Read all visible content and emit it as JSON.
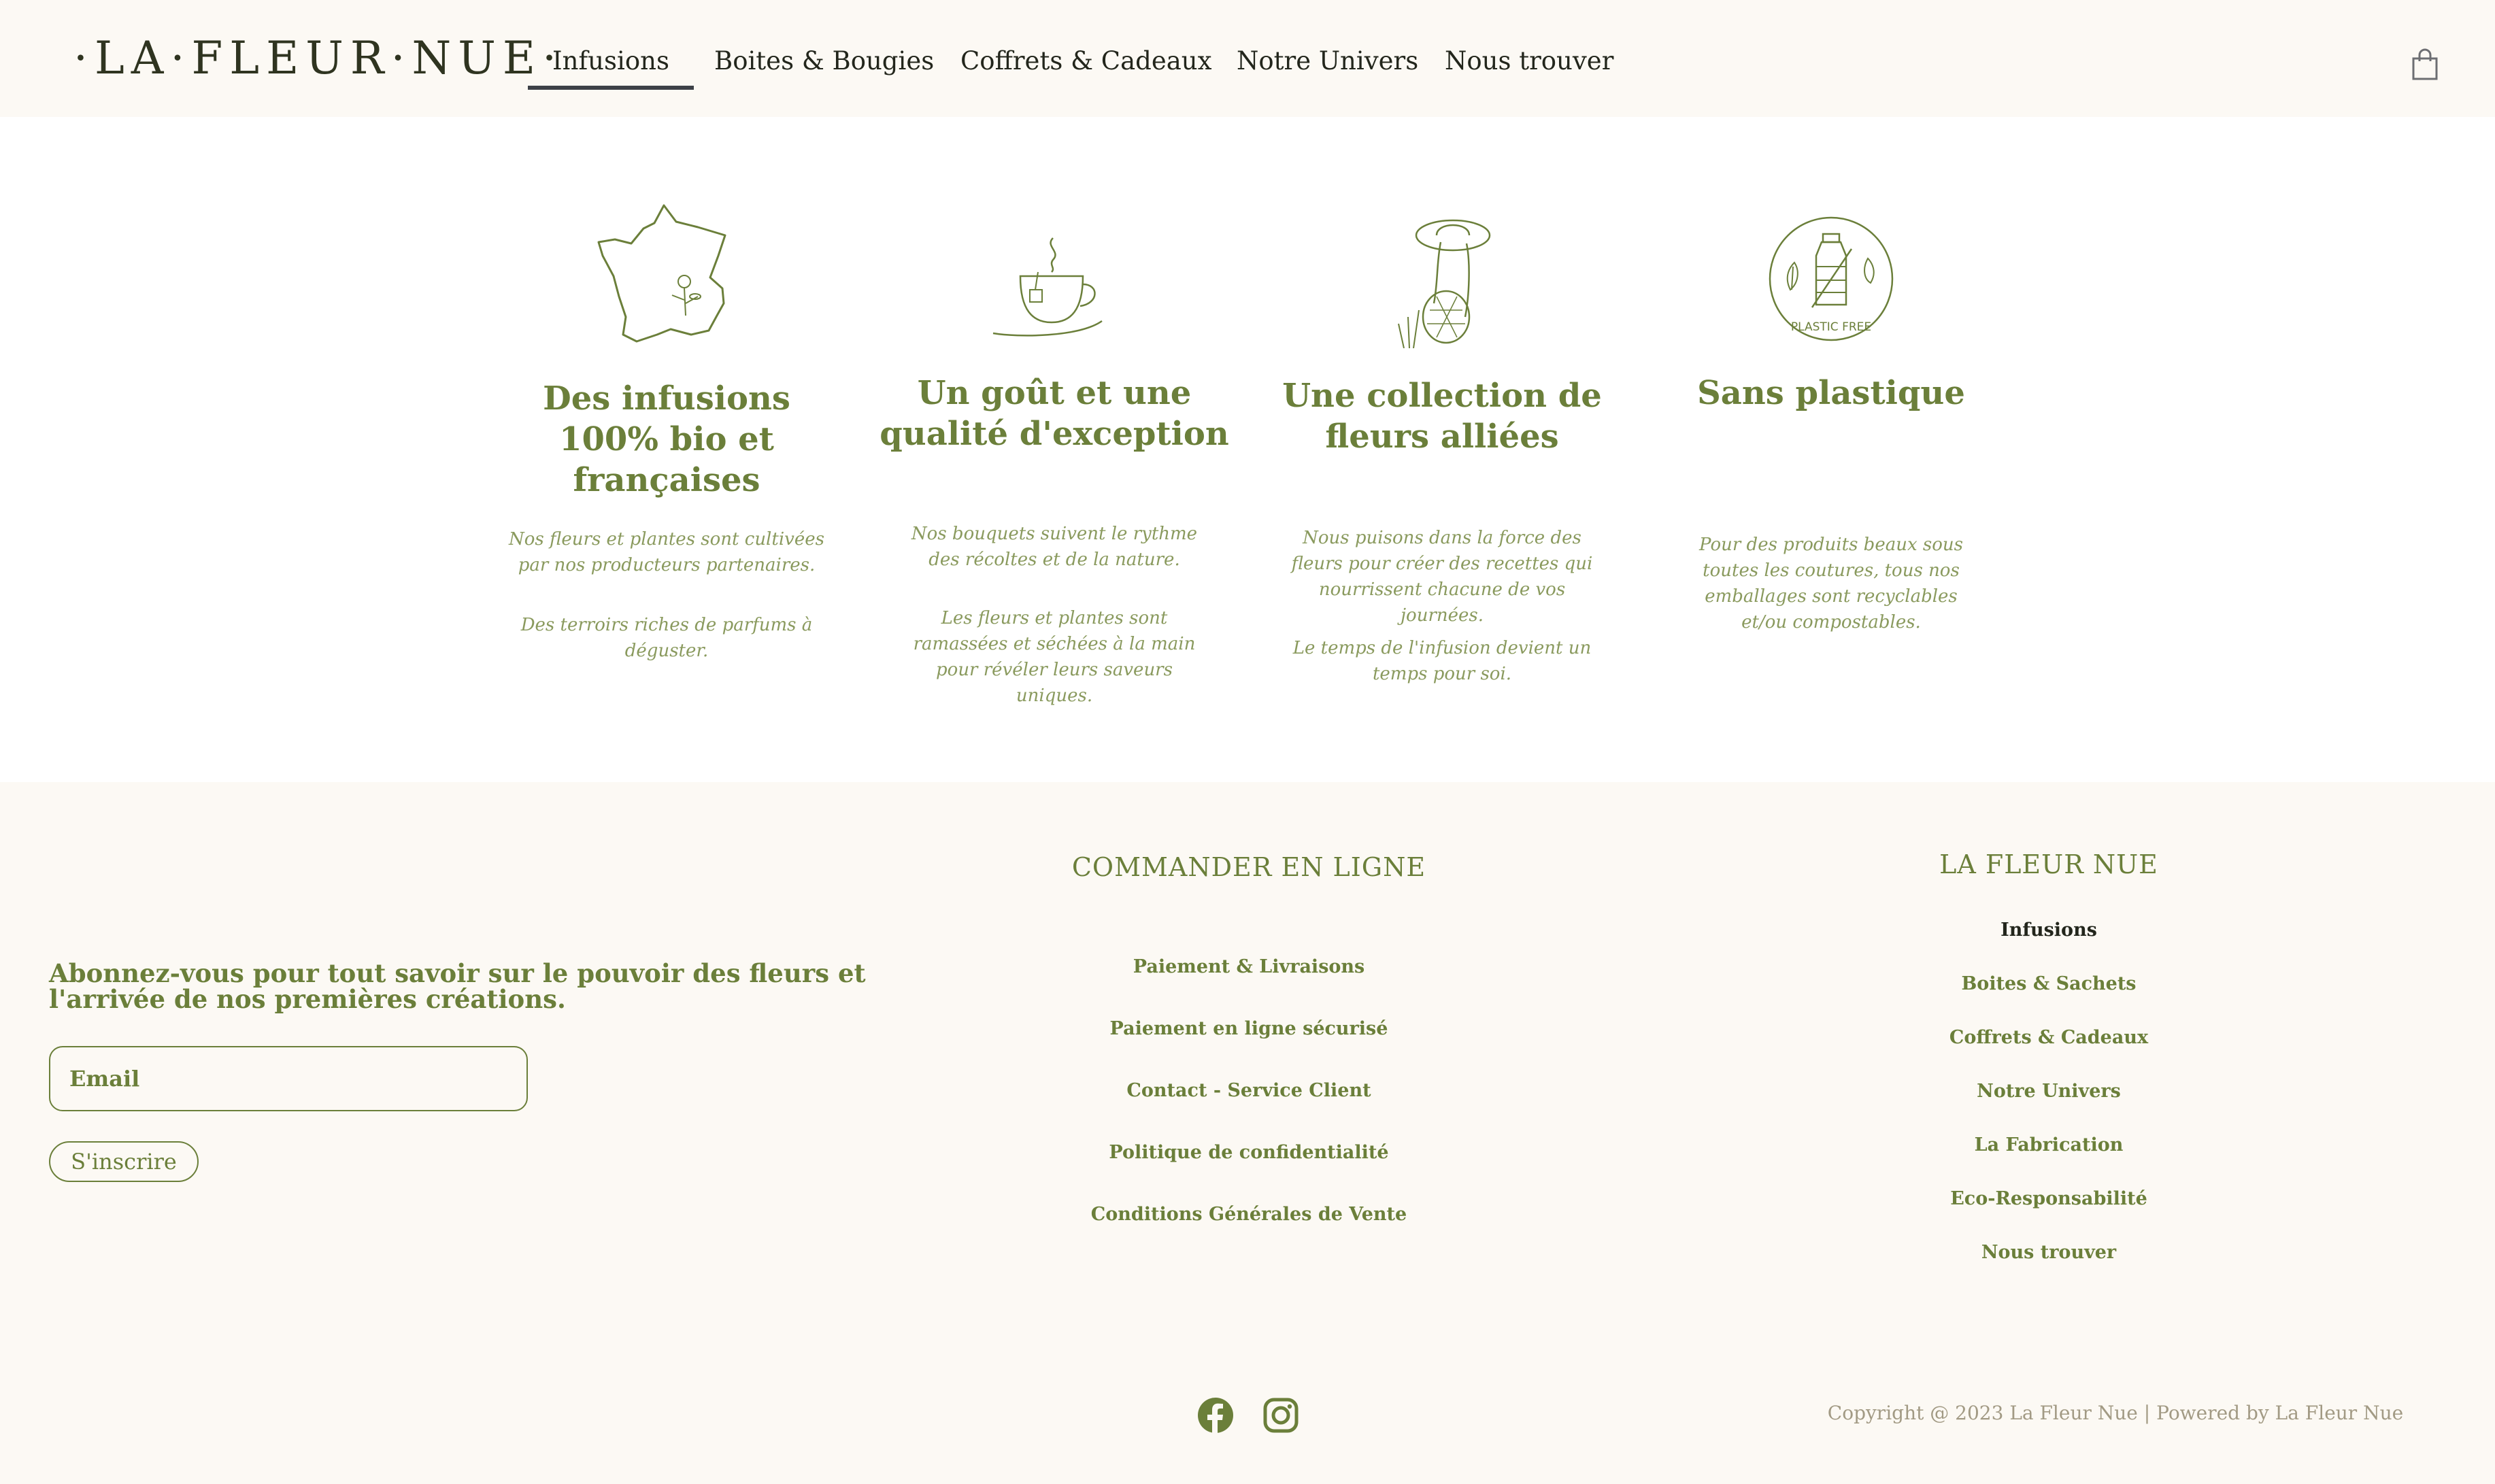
{
  "header": {
    "logo": "·LA·FLEUR·NUE·",
    "nav": [
      {
        "label": "Infusions",
        "active": true
      },
      {
        "label": "Boites & Bougies"
      },
      {
        "label": "Coffrets & Cadeaux"
      },
      {
        "label": "Notre Univers"
      },
      {
        "label": "Nous trouver"
      }
    ],
    "cart_icon": "shopping-bag-icon"
  },
  "features": [
    {
      "icon": "france-map-flower-icon",
      "title": "Des infusions 100% bio et françaises",
      "text1": "Nos fleurs et plantes sont cultivées par nos producteurs partenaires.",
      "text2": "Des terroirs riches de parfums à déguster."
    },
    {
      "icon": "tea-cup-icon",
      "title": "Un goût et une qualité d'exception",
      "text1": "Nos bouquets suivent le rythme des récoltes et de la nature.",
      "text2": "Les fleurs et plantes sont ramassées et séchées à la main pour révéler leurs saveurs uniques."
    },
    {
      "icon": "woman-flower-basket-icon",
      "title": "Une collection de fleurs alliées",
      "text1": "Nous puisons dans la force des fleurs pour créer des recettes qui nourrissent chacune de vos journées.",
      "text2": "Le temps de l'infusion devient un temps pour soi."
    },
    {
      "icon": "plastic-free-icon",
      "icon_text": "PLASTIC FREE",
      "title": "Sans plastique",
      "text1": "Pour des produits beaux sous toutes les coutures, tous nos emballages sont recyclables et/ou compostables.",
      "text2": ""
    }
  ],
  "footer": {
    "newsletter": {
      "title": "Abonnez-vous pour tout savoir sur le pouvoir des fleurs et l'arrivée de nos premières créations.",
      "email_placeholder": "Email",
      "subscribe_label": "S'inscrire"
    },
    "commander": {
      "title": "COMMANDER EN LIGNE",
      "links": [
        "Paiement & Livraisons",
        "Paiement en ligne sécurisé",
        "Contact - Service Client",
        "Politique de confidentialité",
        "Conditions Générales de Vente"
      ]
    },
    "lafleur": {
      "title": "LA FLEUR NUE",
      "links": [
        "Infusions",
        "Boites & Sachets",
        "Coffrets & Cadeaux",
        "Notre Univers",
        "La Fabrication",
        "Eco-Responsabilité",
        "Nous trouver"
      ]
    },
    "social": [
      "facebook-icon",
      "instagram-icon"
    ],
    "copyright": "Copyright @ 2023 La Fleur Nue | Powered by La Fleur Nue"
  },
  "colors": {
    "accent": "#6b7f3a",
    "header_bg": "#fcf9f4",
    "footer_bg": "#fcf9f4",
    "nav_text": "#23261c"
  }
}
